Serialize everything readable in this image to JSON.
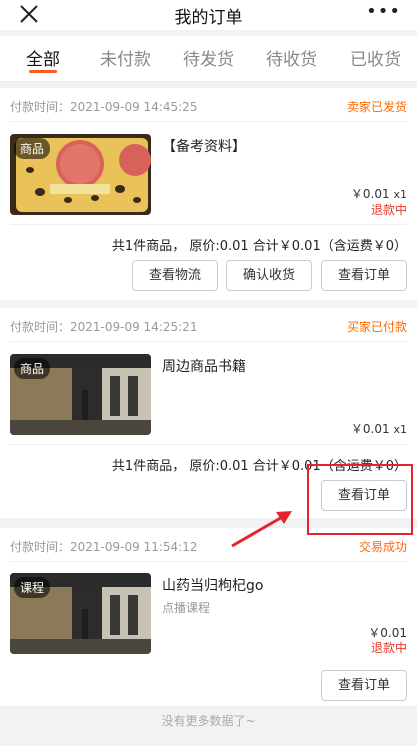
{
  "navbar": {
    "title": "我的订单",
    "close_icon": "close-icon",
    "more_label": "•••"
  },
  "tabs": [
    {
      "label": "全部",
      "active": true
    },
    {
      "label": "未付款",
      "active": false
    },
    {
      "label": "待发货",
      "active": false
    },
    {
      "label": "待收货",
      "active": false
    },
    {
      "label": "已收货",
      "active": false
    }
  ],
  "colors": {
    "accent": "#ff5a1f",
    "status_orange": "#ff6a00",
    "refund_red": "#e23a2c",
    "highlight_red": "#e5232d"
  },
  "orders": [
    {
      "pay_time": "付款时间：2021-09-09 14:45:25",
      "status": "卖家已发货",
      "tag": "商品",
      "title": "【备考资料】",
      "price": "￥0.01",
      "qty": "x1",
      "refund": "退款中",
      "summary": "共1件商品，  原价:0.01 合计￥0.01（含运费￥0）",
      "buttons": [
        "查看物流",
        "确认收货",
        "查看订单"
      ]
    },
    {
      "pay_time": "付款时间：2021-09-09 14:25:21",
      "status": "买家已付款",
      "tag": "商品",
      "title": "周边商品书籍",
      "price": "￥0.01",
      "qty": "x1",
      "summary": "共1件商品，  原价:0.01 合计￥0.01（含运费￥0）",
      "buttons": [
        "查看订单"
      ]
    },
    {
      "pay_time": "付款时间：2021-09-09 11:54:12",
      "status": "交易成功",
      "tag": "课程",
      "title": "山药当归枸杞go",
      "subtitle": "点播课程",
      "price": "￥0.01",
      "refund": "退款中",
      "buttons": [
        "查看订单"
      ]
    }
  ],
  "footer": "没有更多数据了~"
}
